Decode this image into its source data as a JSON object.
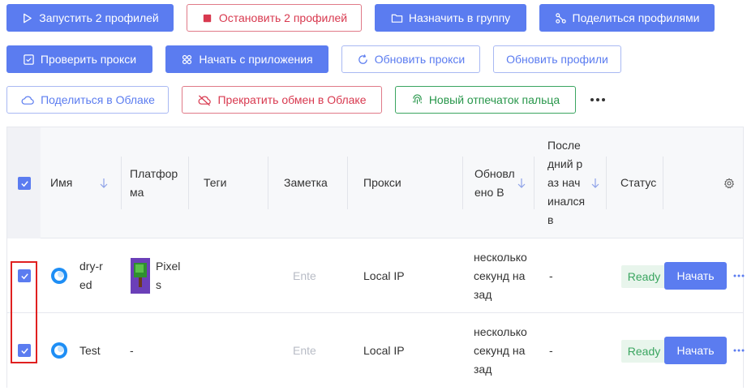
{
  "toolbar": {
    "row1": {
      "launch": "Запустить 2 профилей",
      "stop": "Остановить 2 профилей",
      "assign_group": "Назначить в группу",
      "share_profiles": "Поделиться профилями"
    },
    "row2": {
      "check_proxy": "Проверить прокси",
      "start_from_app": "Начать с приложения",
      "update_proxy": "Обновить прокси",
      "update_profiles": "Обновить профили"
    },
    "row3": {
      "share_cloud": "Поделиться в Облаке",
      "stop_cloud": "Прекратить обмен в Облаке",
      "new_fingerprint": "Новый отпечаток пальца"
    }
  },
  "table": {
    "headers": {
      "name": "Имя",
      "platform": "Платформа",
      "tags": "Теги",
      "note": "Заметка",
      "proxy": "Прокси",
      "updated": "Обновлено В",
      "last_started": "Последний раз начинался в",
      "status": "Статус"
    },
    "rows": [
      {
        "name": "dry-red",
        "platform": "Pixels",
        "tags": "",
        "note_placeholder": "Ente",
        "proxy": "Local IP",
        "updated": "несколько секунд назад",
        "last_started": "-",
        "status": "Ready",
        "action": "Начать"
      },
      {
        "name": "Test",
        "platform": "-",
        "tags": "",
        "note_placeholder": "Ente",
        "proxy": "Local IP",
        "updated": "несколько секунд назад",
        "last_started": "-",
        "status": "Ready",
        "action": "Начать"
      }
    ]
  },
  "colors": {
    "primary": "#5b7cf0",
    "danger": "#d8394f",
    "success": "#27964a",
    "ready_bg": "#e8f5ec",
    "highlight": "#e02020"
  }
}
